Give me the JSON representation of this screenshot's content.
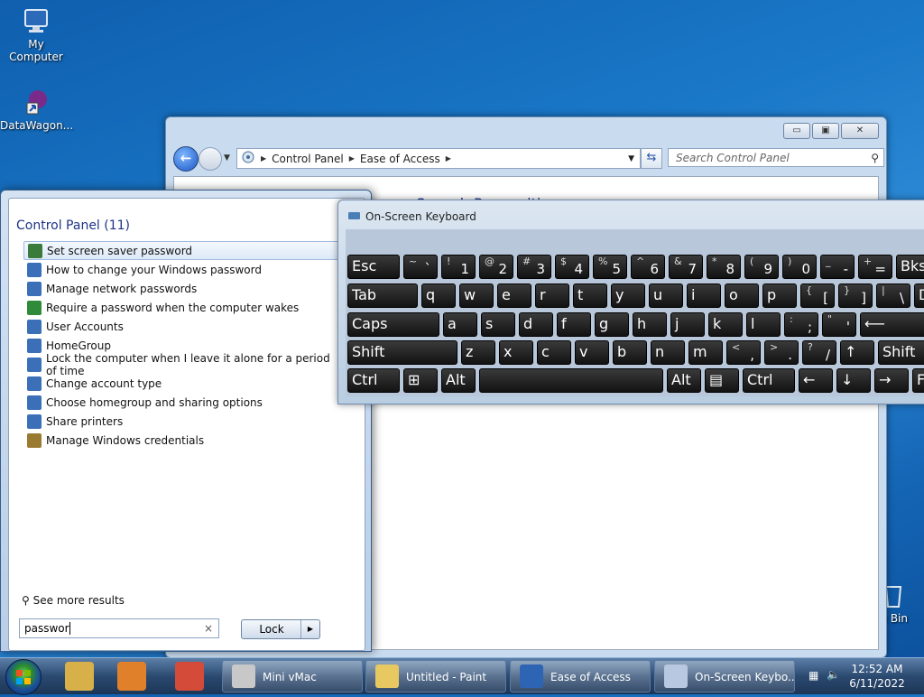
{
  "desktop": {
    "icons": [
      {
        "label": "My Computer",
        "icon": "computer-icon"
      },
      {
        "label": "DataWagon...",
        "icon": "datawagon-shortcut-icon"
      },
      {
        "label": "e Bin",
        "icon": "recycle-bin-icon"
      }
    ]
  },
  "control_panel": {
    "breadcrumb": [
      "Control Panel",
      "Ease of Access"
    ],
    "search_placeholder": "Search Control Panel",
    "content_heading": "Speech Recognition",
    "buttons": {
      "minimize": "▭",
      "maximize": "▣",
      "close": "✕"
    }
  },
  "start_menu": {
    "group_title": "Control Panel (11)",
    "items": [
      {
        "label": "Set screen saver password",
        "color": "#3a7a3a"
      },
      {
        "label": "How to change your Windows password",
        "color": "#3b6fb8"
      },
      {
        "label": "Manage network passwords",
        "color": "#3b6fb8"
      },
      {
        "label": "Require a password when the computer wakes",
        "color": "#2f8a3a"
      },
      {
        "label": "User Accounts",
        "color": "#3b6fb8"
      },
      {
        "label": "HomeGroup",
        "color": "#3b6fb8"
      },
      {
        "label": "Lock the computer when I leave it alone for a period of time",
        "color": "#3b6fb8"
      },
      {
        "label": "Change account type",
        "color": "#3b6fb8"
      },
      {
        "label": "Choose homegroup and sharing options",
        "color": "#3b6fb8"
      },
      {
        "label": "Share printers",
        "color": "#3b6fb8"
      },
      {
        "label": "Manage Windows credentials",
        "color": "#9a7a30"
      }
    ],
    "see_more": "See more results",
    "search_value": "passwor",
    "clear_glyph": "×",
    "lock_label": "Lock"
  },
  "osk": {
    "title": "On-Screen Keyboard",
    "rows": [
      [
        {
          "m": "Esc"
        },
        {
          "u": "~",
          "l": "`"
        },
        {
          "u": "!",
          "l": "1"
        },
        {
          "u": "@",
          "l": "2"
        },
        {
          "u": "#",
          "l": "3"
        },
        {
          "u": "$",
          "l": "4"
        },
        {
          "u": "%",
          "l": "5"
        },
        {
          "u": "^",
          "l": "6"
        },
        {
          "u": "&",
          "l": "7"
        },
        {
          "u": "*",
          "l": "8"
        },
        {
          "u": "(",
          "l": "9"
        },
        {
          "u": ")",
          "l": "0"
        },
        {
          "u": "_",
          "l": "-"
        },
        {
          "u": "+",
          "l": "="
        },
        {
          "m": "Bks"
        }
      ],
      [
        {
          "m": "Tab"
        },
        {
          "m": "q"
        },
        {
          "m": "w"
        },
        {
          "m": "e"
        },
        {
          "m": "r"
        },
        {
          "m": "t"
        },
        {
          "m": "y"
        },
        {
          "m": "u"
        },
        {
          "m": "i"
        },
        {
          "m": "o"
        },
        {
          "m": "p"
        },
        {
          "u": "{",
          "l": "["
        },
        {
          "u": "}",
          "l": "]"
        },
        {
          "u": "|",
          "l": "\\"
        },
        {
          "m": "D"
        }
      ],
      [
        {
          "m": "Caps"
        },
        {
          "m": "a"
        },
        {
          "m": "s"
        },
        {
          "m": "d"
        },
        {
          "m": "f"
        },
        {
          "m": "g"
        },
        {
          "m": "h"
        },
        {
          "m": "j"
        },
        {
          "m": "k"
        },
        {
          "m": "l"
        },
        {
          "u": ":",
          "l": ";"
        },
        {
          "u": "\"",
          "l": "'"
        },
        {
          "m": "⟵"
        }
      ],
      [
        {
          "m": "Shift"
        },
        {
          "m": "z"
        },
        {
          "m": "x"
        },
        {
          "m": "c"
        },
        {
          "m": "v"
        },
        {
          "m": "b"
        },
        {
          "m": "n"
        },
        {
          "m": "m"
        },
        {
          "u": "<",
          "l": ","
        },
        {
          "u": ">",
          "l": "."
        },
        {
          "u": "?",
          "l": "/"
        },
        {
          "m": "↑"
        },
        {
          "m": "Shift"
        }
      ],
      [
        {
          "m": "Ctrl"
        },
        {
          "m": "⊞"
        },
        {
          "m": "Alt"
        },
        {
          "m": ""
        },
        {
          "m": "Alt"
        },
        {
          "m": "▤"
        },
        {
          "m": "Ctrl"
        },
        {
          "m": "←"
        },
        {
          "m": "↓"
        },
        {
          "m": "→"
        },
        {
          "m": "F"
        }
      ]
    ]
  },
  "taskbar": {
    "pinned": [
      {
        "name": "explorer-pin-icon",
        "color": "#d8b04a"
      },
      {
        "name": "media-player-pin-icon",
        "color": "#e0802a"
      },
      {
        "name": "chrome-pin-icon",
        "color": "#d44b3a"
      }
    ],
    "tasks": [
      {
        "label": "Mini vMac",
        "color": "#c8c8c8"
      },
      {
        "label": "Untitled - Paint",
        "color": "#e8c860"
      },
      {
        "label": "Ease of Access",
        "color": "#2e64b4"
      },
      {
        "label": "On-Screen Keybo...",
        "color": "#b8c8e0"
      }
    ],
    "time": "12:52 AM",
    "date": "6/11/2022"
  }
}
